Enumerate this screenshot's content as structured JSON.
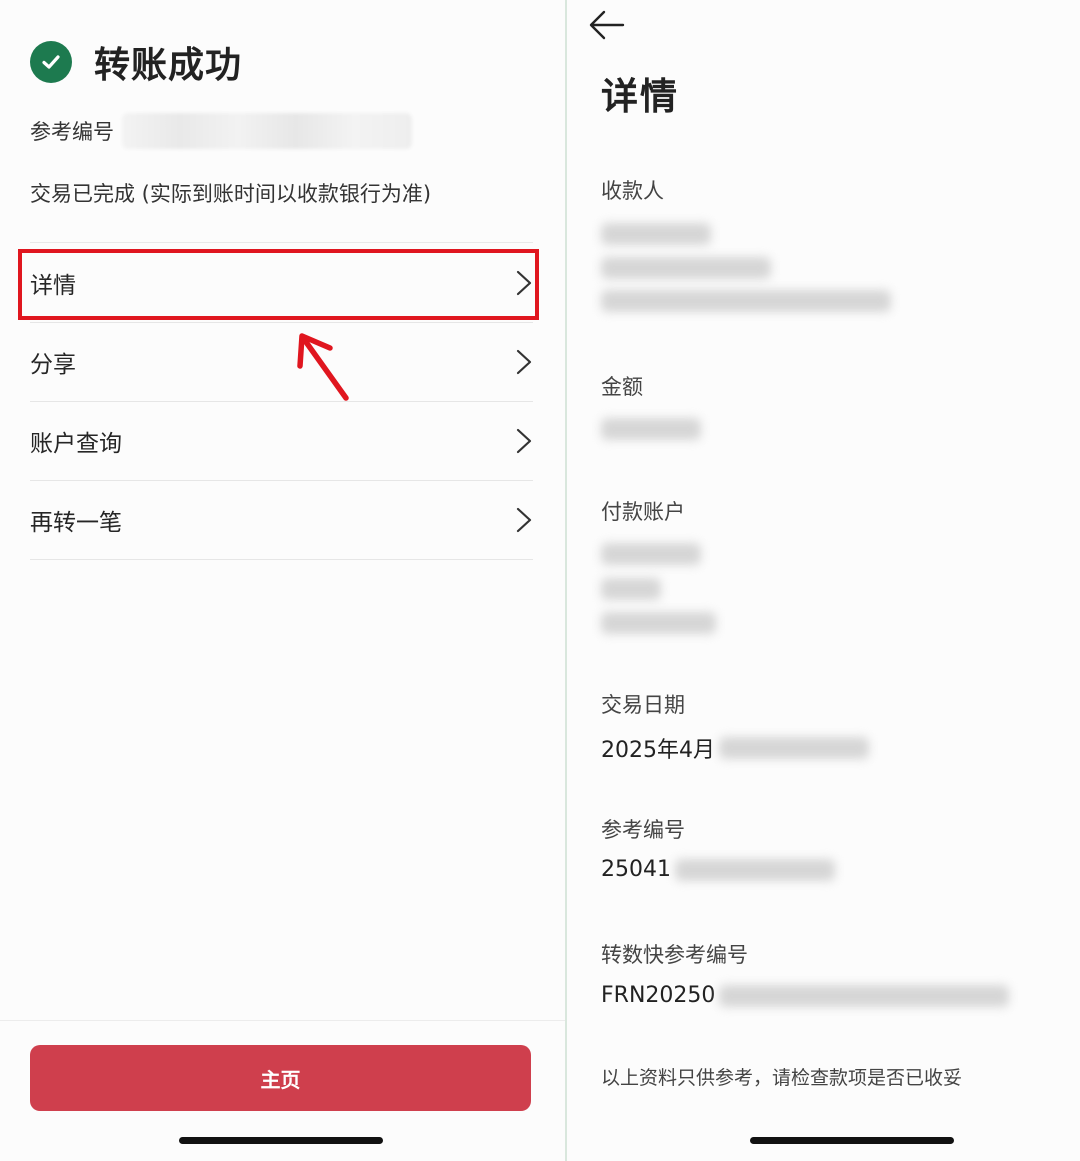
{
  "left": {
    "title": "转账成功",
    "ref_label": "参考编号",
    "status": "交易已完成 (实际到账时间以收款银行为准)",
    "menu": [
      {
        "label": "详情"
      },
      {
        "label": "分享"
      },
      {
        "label": "账户查询"
      },
      {
        "label": "再转一笔"
      }
    ],
    "home_button": "主页"
  },
  "right": {
    "title": "详情",
    "fields": {
      "payee": {
        "label": "收款人"
      },
      "amount": {
        "label": "金额"
      },
      "pay_account": {
        "label": "付款账户"
      },
      "date": {
        "label": "交易日期",
        "value": "2025年4月"
      },
      "ref": {
        "label": "参考编号",
        "value": "25041"
      },
      "fps_ref": {
        "label": "转数快参考编号",
        "value": "FRN20250"
      }
    },
    "note": "以上资料只供参考，请检查款项是否已收妥"
  },
  "colors": {
    "success_green": "#1d7a4f",
    "highlight_red": "#e0161f",
    "button_red": "#cf3f4d"
  },
  "icons": [
    "check-circle-icon",
    "chevron-right-icon",
    "red-arrow-icon",
    "back-arrow-icon"
  ]
}
